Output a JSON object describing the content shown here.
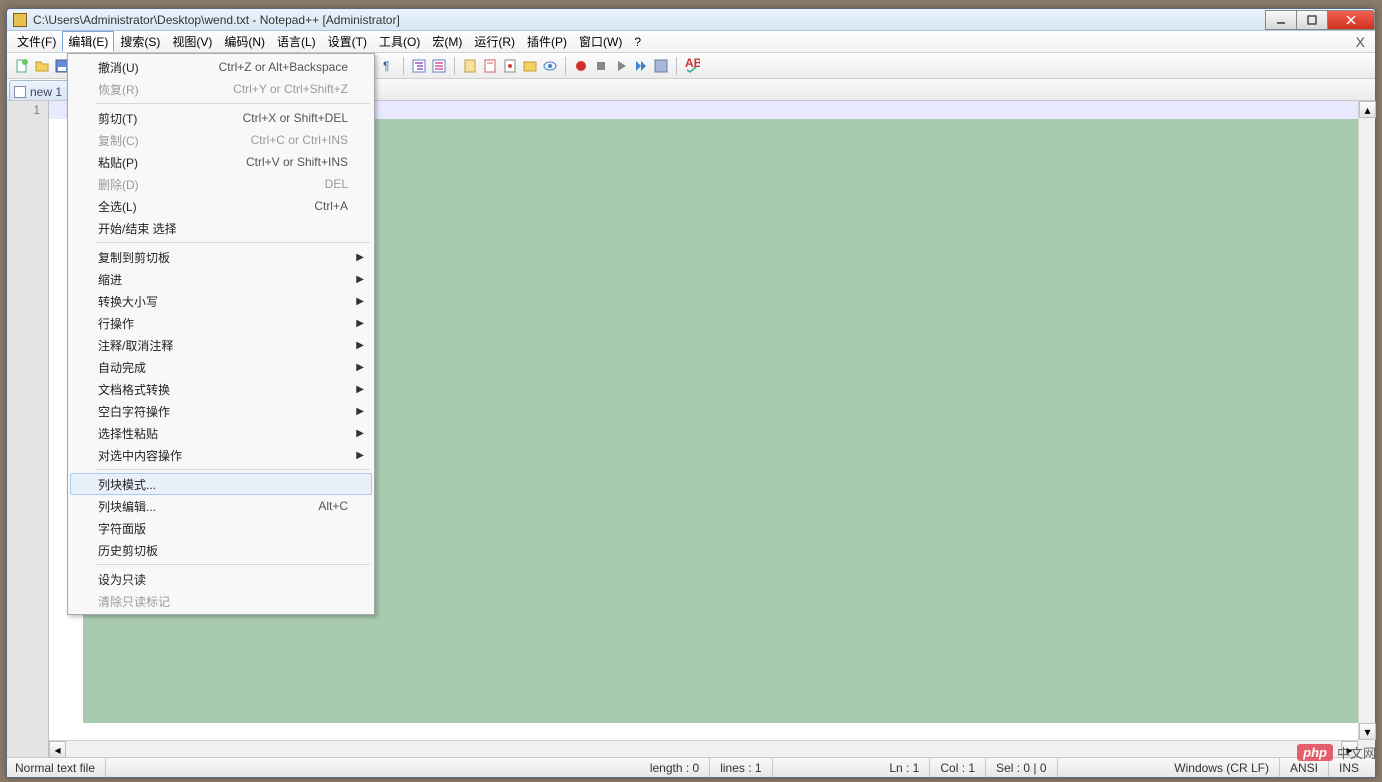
{
  "window": {
    "title": "C:\\Users\\Administrator\\Desktop\\wend.txt - Notepad++ [Administrator]"
  },
  "menubar": {
    "items": [
      "文件(F)",
      "编辑(E)",
      "搜索(S)",
      "视图(V)",
      "编码(N)",
      "语言(L)",
      "设置(T)",
      "工具(O)",
      "宏(M)",
      "运行(R)",
      "插件(P)",
      "窗口(W)",
      "?"
    ],
    "close_x": "X"
  },
  "tabs": [
    {
      "label": "new 1"
    }
  ],
  "gutter": {
    "line1": "1"
  },
  "dropdown": {
    "groups": [
      [
        {
          "label": "撤消(U)",
          "shortcut": "Ctrl+Z or Alt+Backspace",
          "disabled": false
        },
        {
          "label": "恢复(R)",
          "shortcut": "Ctrl+Y or Ctrl+Shift+Z",
          "disabled": true
        }
      ],
      [
        {
          "label": "剪切(T)",
          "shortcut": "Ctrl+X or Shift+DEL",
          "disabled": false
        },
        {
          "label": "复制(C)",
          "shortcut": "Ctrl+C or Ctrl+INS",
          "disabled": true
        },
        {
          "label": "粘贴(P)",
          "shortcut": "Ctrl+V or Shift+INS",
          "disabled": false
        },
        {
          "label": "删除(D)",
          "shortcut": "DEL",
          "disabled": true
        },
        {
          "label": "全选(L)",
          "shortcut": "Ctrl+A",
          "disabled": false
        },
        {
          "label": "开始/结束 选择",
          "shortcut": "",
          "disabled": false
        }
      ],
      [
        {
          "label": "复制到剪切板",
          "submenu": true
        },
        {
          "label": "缩进",
          "submenu": true
        },
        {
          "label": "转换大小写",
          "submenu": true
        },
        {
          "label": "行操作",
          "submenu": true
        },
        {
          "label": "注释/取消注释",
          "submenu": true
        },
        {
          "label": "自动完成",
          "submenu": true
        },
        {
          "label": "文档格式转换",
          "submenu": true
        },
        {
          "label": "空白字符操作",
          "submenu": true
        },
        {
          "label": "选择性粘贴",
          "submenu": true
        },
        {
          "label": "对选中内容操作",
          "submenu": true
        }
      ],
      [
        {
          "label": "列块模式...",
          "hover": true
        },
        {
          "label": "列块编辑...",
          "shortcut": "Alt+C"
        },
        {
          "label": "字符面版"
        },
        {
          "label": "历史剪切板"
        }
      ],
      [
        {
          "label": "设为只读"
        },
        {
          "label": "清除只读标记",
          "disabled": true
        }
      ]
    ]
  },
  "statusbar": {
    "filetype": "Normal text file",
    "length": "length : 0",
    "lines": "lines : 1",
    "ln": "Ln : 1",
    "col": "Col : 1",
    "sel": "Sel : 0 | 0",
    "eol": "Windows (CR LF)",
    "encoding": "ANSI",
    "ins": "INS"
  },
  "watermark": {
    "logo": "php",
    "text": "中文网"
  }
}
